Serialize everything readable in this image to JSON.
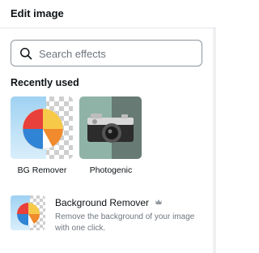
{
  "header": {
    "title": "Edit image"
  },
  "search": {
    "placeholder": "Search effects",
    "value": ""
  },
  "recently_used": {
    "title": "Recently used",
    "items": [
      {
        "label": "BG Remover",
        "icon": "beach-ball-transparent-thumbnail"
      },
      {
        "label": "Photogenic",
        "icon": "camera-photo-thumbnail"
      }
    ]
  },
  "effects": [
    {
      "title": "Background Remover",
      "badge_icon": "crown-icon",
      "description": "Remove the background of your image with one click.",
      "icon": "beach-ball-transparent-thumbnail"
    }
  ],
  "colors": {
    "text": "#0d1216",
    "muted": "#6f767e",
    "border": "#8e969e",
    "divider": "#e3e5e8"
  }
}
